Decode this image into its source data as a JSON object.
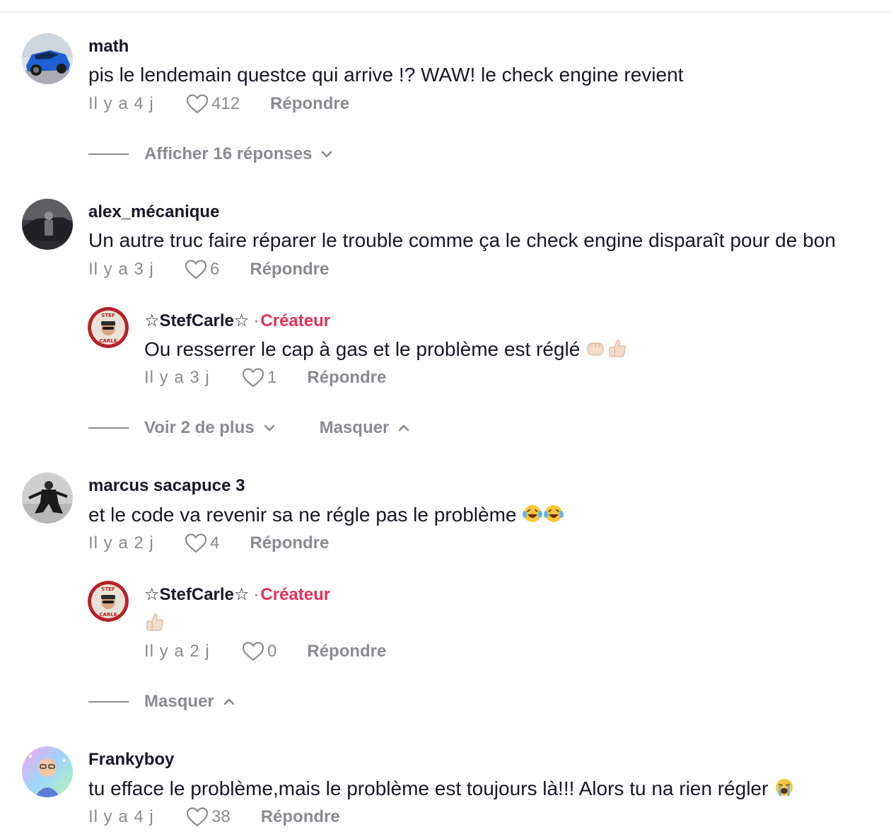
{
  "comments": [
    {
      "username": "math",
      "text": "pis le lendemain questce qui arrive !? WAW! le check engine revient",
      "time": "Il y a 4 j",
      "likes": "412",
      "reply_label": "Répondre",
      "thread": {
        "show_replies": "Afficher 16 réponses"
      }
    },
    {
      "username": "alex_mécanique",
      "text": "Un autre truc faire réparer le trouble comme ça le check engine disparaît pour de bon",
      "time": "Il y a 3 j",
      "likes": "6",
      "reply_label": "Répondre",
      "reply": {
        "username": "☆StefCarle☆",
        "creator_label": "Créateur",
        "text": "Ou resserrer le cap à gas et le problème est réglé",
        "time": "Il y a 3 j",
        "likes": "1",
        "reply_label": "Répondre"
      },
      "thread": {
        "see_more": "Voir 2 de plus",
        "hide": "Masquer"
      }
    },
    {
      "username": "marcus sacapuce 3",
      "text": "et le code va revenir sa ne régle pas le problème",
      "time": "Il y a 2 j",
      "likes": "4",
      "reply_label": "Répondre",
      "reply": {
        "username": "☆StefCarle☆",
        "creator_label": "Créateur",
        "text": "",
        "time": "Il y a 2 j",
        "likes": "0",
        "reply_label": "Répondre"
      },
      "thread": {
        "hide": "Masquer"
      }
    },
    {
      "username": "Frankyboy",
      "text": "tu efface le problème,mais le problème est toujours là!!! Alors tu na rien régler",
      "time": "Il y a 4 j",
      "likes": "38",
      "reply_label": "Répondre"
    }
  ],
  "colors": {
    "creator": "#e2315a",
    "muted": "#8a8b91",
    "text": "#161823"
  },
  "icons": [
    "heart-icon",
    "chevron-down-icon",
    "chevron-up-icon",
    "fist-emoji",
    "thumbs-up-emoji",
    "laughing-crying-emoji",
    "crying-emoji"
  ]
}
